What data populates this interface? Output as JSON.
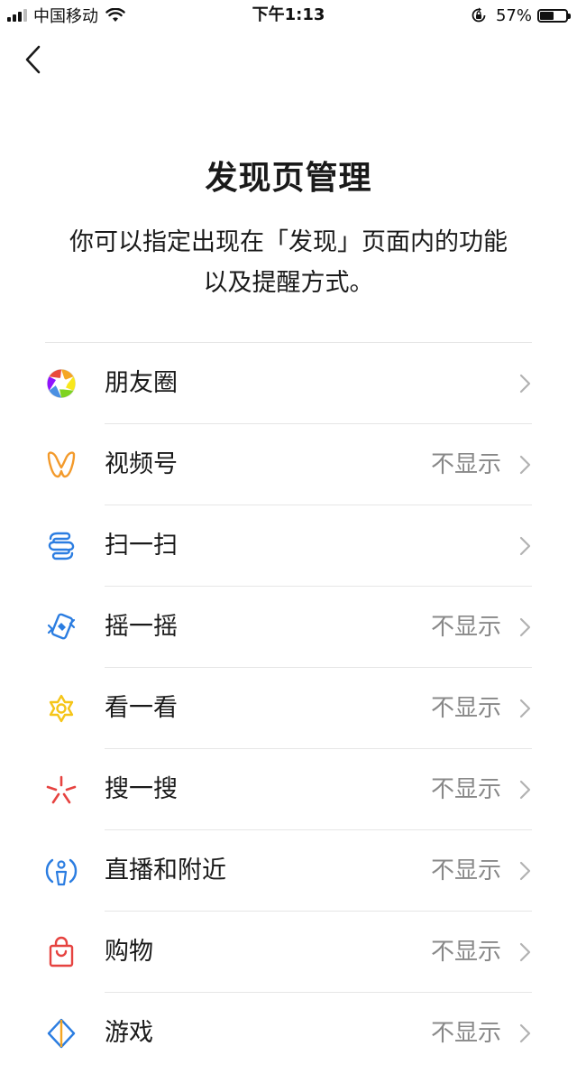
{
  "status_bar": {
    "carrier": "中国移动",
    "time": "下午1:13",
    "battery_percent": "57%",
    "battery_level": 0.57
  },
  "header": {
    "title": "发现页管理",
    "description_line1": "你可以指定出现在「发现」页面内的功能",
    "description_line2": "以及提醒方式。"
  },
  "items": [
    {
      "label": "朋友圈",
      "status": "",
      "icon": "moments-icon"
    },
    {
      "label": "视频号",
      "status": "不显示",
      "icon": "channels-icon"
    },
    {
      "label": "扫一扫",
      "status": "",
      "icon": "scan-icon"
    },
    {
      "label": "摇一摇",
      "status": "不显示",
      "icon": "shake-icon"
    },
    {
      "label": "看一看",
      "status": "不显示",
      "icon": "top-stories-icon"
    },
    {
      "label": "搜一搜",
      "status": "不显示",
      "icon": "search-icon"
    },
    {
      "label": "直播和附近",
      "status": "不显示",
      "icon": "live-nearby-icon"
    },
    {
      "label": "购物",
      "status": "不显示",
      "icon": "shopping-bag-icon"
    },
    {
      "label": "游戏",
      "status": "不显示",
      "icon": "games-icon"
    }
  ],
  "colors": {
    "moments": [
      "#f5a623",
      "#7ed321",
      "#4a90e2",
      "#9013fe",
      "#e94b3c",
      "#f8e71c"
    ],
    "channels": "#f39a2b",
    "scan": "#2b7de1",
    "shake": "#2b7de1",
    "top_stories": "#f5c518",
    "search": "#e64340",
    "live_nearby": "#2b7de1",
    "shopping": "#e64340",
    "games": "#2b7de1"
  }
}
